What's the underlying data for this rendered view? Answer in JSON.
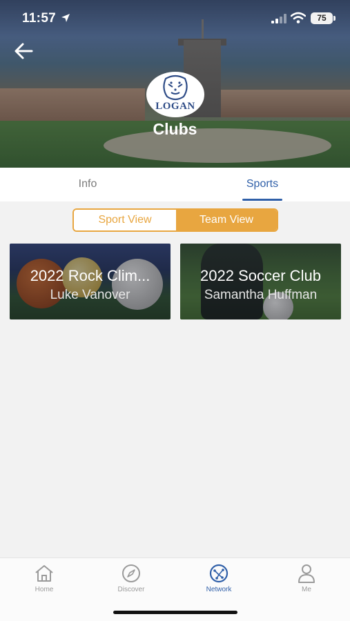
{
  "status_bar": {
    "time": "11:57",
    "battery": "75"
  },
  "header": {
    "title": "Clubs",
    "logo_text": "LOGAN"
  },
  "tabs": [
    {
      "label": "Info",
      "active": false
    },
    {
      "label": "Sports",
      "active": true
    }
  ],
  "view_toggle": {
    "options": [
      "Sport View",
      "Team View"
    ],
    "selected": "Team View"
  },
  "clubs": [
    {
      "title": "2022 Rock Clim...",
      "leader": "Luke Vanover"
    },
    {
      "title": "2022 Soccer Club",
      "leader": "Samantha Huffman"
    }
  ],
  "bottom_nav": [
    {
      "label": "Home",
      "icon": "home-icon"
    },
    {
      "label": "Discover",
      "icon": "compass-icon"
    },
    {
      "label": "Network",
      "icon": "network-icon",
      "active": true
    },
    {
      "label": "Me",
      "icon": "person-icon"
    }
  ],
  "colors": {
    "accent": "#e8a640",
    "primary": "#2f5fa8"
  }
}
